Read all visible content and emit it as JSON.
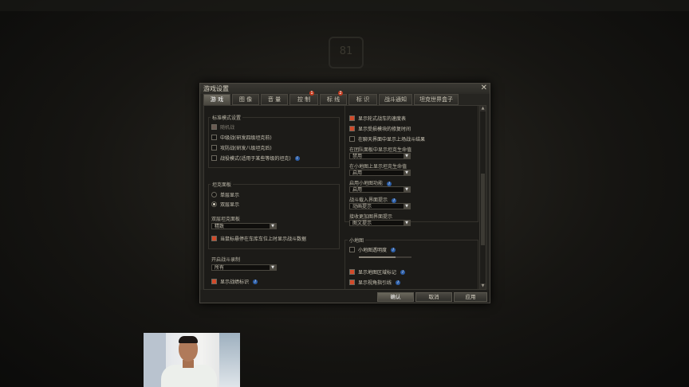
{
  "dialog": {
    "title": "游戏设置",
    "close_glyph": "✕",
    "tabs": [
      {
        "label": "游 戏",
        "active": true
      },
      {
        "label": "图 像"
      },
      {
        "label": "音 量"
      },
      {
        "label": "控 制",
        "badge": "1"
      },
      {
        "label": "标 线",
        "badge": "2"
      },
      {
        "label": "标 识"
      },
      {
        "label": "战斗通知"
      },
      {
        "label": "坦克世界盒子"
      }
    ]
  },
  "left": {
    "std_mode_title": "标准模式设置",
    "std_mode_items": [
      {
        "label": "随机战",
        "checked": true,
        "disabled": true
      },
      {
        "label": "中级战(研发四级坦克前)",
        "checked": false
      },
      {
        "label": "攻防战(研发八级坦克后)",
        "checked": false
      },
      {
        "label": "战役模式(适用于某些等级的坦克)",
        "checked": false,
        "info": true
      }
    ],
    "tank_panel_title": "坦克面板",
    "tank_panel_options": [
      {
        "label": "单层显示",
        "selected": false
      },
      {
        "label": "双层显示",
        "selected": true
      }
    ],
    "double_panel_label": "双层坦克面板",
    "double_panel_value": "精致",
    "hover_check": "当鼠标悬停在车库车位上时显示战斗数据",
    "battle_record_label": "开启战斗录制",
    "battle_record_value": "所有",
    "show_battle_marks": "显示战绩标识"
  },
  "right": {
    "items_top": [
      {
        "label": "显示轮式战车的速度表",
        "checked": true
      },
      {
        "label": "显示受损模块的修复时间",
        "checked": true
      },
      {
        "label": "在聊天界面中显示上场战斗结果",
        "checked": false
      }
    ],
    "selects": [
      {
        "label": "在团队面板中显示坦克生命值",
        "value": "禁用"
      },
      {
        "label": "在小地图上显示坦克生命值",
        "value": "启用"
      },
      {
        "label": "启用小地图功能",
        "value": "启用",
        "info": true
      },
      {
        "label": "战斗载入界面提示",
        "value": "动画提示",
        "info": true
      },
      {
        "label": "接收更加图界面提示",
        "value": "图文提示"
      }
    ],
    "minimap_title": "小地图",
    "minimap_opacity": "小地图透明度",
    "minimap_opacity_value": 0.7,
    "minimap_items": [
      {
        "label": "显示地图区域标记",
        "checked": true,
        "info": true
      },
      {
        "label": "显示视角指引线",
        "checked": true,
        "info": true
      }
    ]
  },
  "footer": {
    "ok": "确认",
    "cancel": "取消",
    "apply": "应用"
  },
  "background": {
    "emblem_text": "81"
  },
  "colors": {
    "accent": "#d24a2a",
    "info": "#2d5fa8"
  }
}
